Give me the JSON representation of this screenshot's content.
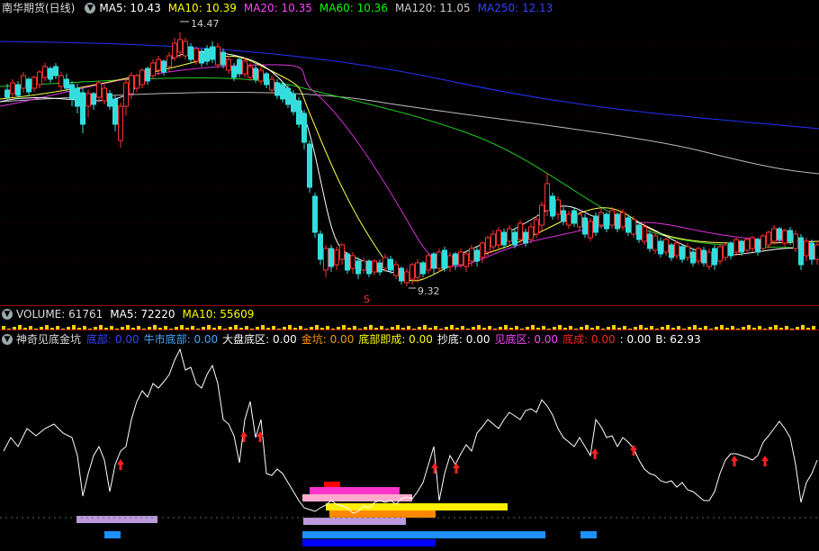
{
  "main": {
    "title": "南华期货(日线)",
    "ma": [
      {
        "label": "MA5: 10.43",
        "color": "#ffffff"
      },
      {
        "label": "MA10: 10.39",
        "color": "#ffff00"
      },
      {
        "label": "MA20: 10.35",
        "color": "#ff44ff"
      },
      {
        "label": "MA60: 10.36",
        "color": "#00ff00"
      },
      {
        "label": "MA120: 11.05",
        "color": "#cccccc"
      },
      {
        "label": "MA250: 12.13",
        "color": "#2233ff"
      }
    ],
    "high_label": "14.47",
    "low_label": "9.32",
    "marker": "S"
  },
  "volume": {
    "title": "VOLUME: 61761",
    "ma5": "MA5: 72220",
    "ma10": "MA10: 55609"
  },
  "indicator": {
    "title": "神奇见底金坑",
    "fields": [
      {
        "label": "底部: 0.00",
        "color": "#3344ff"
      },
      {
        "label": "牛市底部: 0.00",
        "color": "#44aaff"
      },
      {
        "label": "大盘底区: 0.00",
        "color": "#ffffff"
      },
      {
        "label": "金坑: 0.00",
        "color": "#ff9900"
      },
      {
        "label": "底部即成: 0.00",
        "color": "#ffff00"
      },
      {
        "label": "抄底: 0.00",
        "color": "#ffffff"
      },
      {
        "label": "见底区: 0.00",
        "color": "#ff44ff"
      },
      {
        "label": "底成: 0.00",
        "color": "#ff2222"
      },
      {
        "label": ": 0.00",
        "color": "#ffffff"
      },
      {
        "label": "B: 62.93",
        "color": "#ffffff"
      }
    ]
  },
  "colors": {
    "up": "#ff3333",
    "down": "#33dddd",
    "separator": "#a00000"
  }
}
